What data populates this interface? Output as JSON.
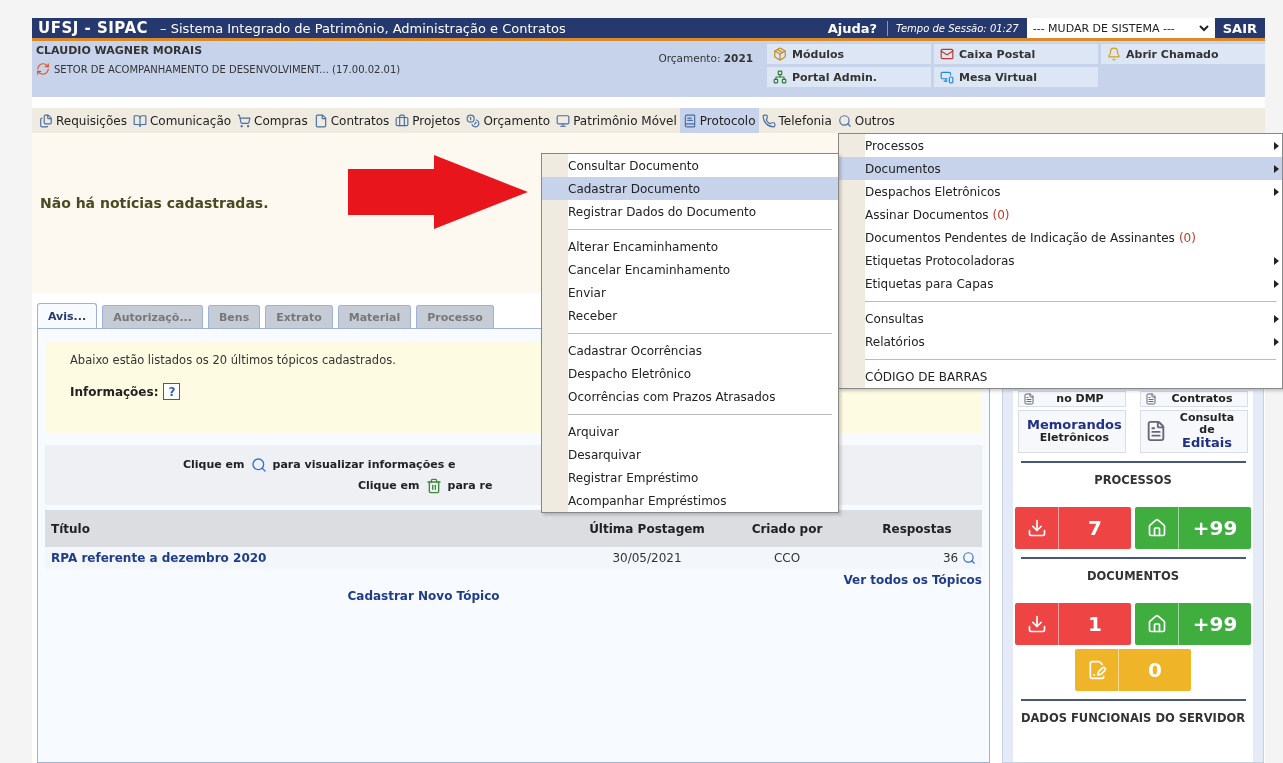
{
  "header": {
    "system": "UFSJ - SIPAC",
    "subtitle": "– Sistema Integrado de Patrimônio, Administração e Contratos",
    "help": "Ajuda?",
    "session_label": "Tempo de Sessão:",
    "session_time": "01:27",
    "system_select": "--- MUDAR DE SISTEMA ---",
    "logout": "SAIR"
  },
  "user": {
    "name": "CLAUDIO WAGNER MORAIS",
    "unit": "SETOR DE ACOMPANHAMENTO DE DESENVOLVIMENT... (17.00.02.01)",
    "budget_label": "Orçamento:",
    "budget_year": "2021"
  },
  "shortcuts": [
    {
      "kind": "modules",
      "label": "Módulos"
    },
    {
      "kind": "mail",
      "label": "Caixa Postal"
    },
    {
      "kind": "bell",
      "label": "Abrir Chamado"
    },
    {
      "kind": "portal",
      "label": "Portal Admin."
    },
    {
      "kind": "desk",
      "label": "Mesa Virtual"
    }
  ],
  "main_menu": [
    {
      "label": "Requisições",
      "selected": false
    },
    {
      "label": "Comunicação",
      "selected": false
    },
    {
      "label": "Compras",
      "selected": false
    },
    {
      "label": "Contratos",
      "selected": false
    },
    {
      "label": "Projetos",
      "selected": false
    },
    {
      "label": "Orçamento",
      "selected": false
    },
    {
      "label": "Patrimônio Móvel",
      "selected": false
    },
    {
      "label": "Protocolo",
      "selected": true
    },
    {
      "label": "Telefonia",
      "selected": false
    },
    {
      "label": "Outros",
      "selected": false
    }
  ],
  "protocol_menu": [
    [
      {
        "label": "Processos",
        "submenu": true,
        "selected": false
      },
      {
        "label": "Documentos",
        "submenu": true,
        "selected": true
      },
      {
        "label": "Despachos Eletrônicos",
        "submenu": true,
        "selected": false
      },
      {
        "label": "Assinar Documentos",
        "count": "(0)",
        "submenu": false,
        "selected": false
      },
      {
        "label": "Documentos Pendentes de Indicação de Assinantes",
        "count": "(0)",
        "submenu": false,
        "selected": false
      },
      {
        "label": "Etiquetas Protocoladoras",
        "submenu": true,
        "selected": false
      },
      {
        "label": "Etiquetas para Capas",
        "submenu": true,
        "selected": false
      }
    ],
    [
      {
        "label": "Consultas",
        "submenu": true,
        "selected": false
      },
      {
        "label": "Relatórios",
        "submenu": true,
        "selected": false
      }
    ],
    [
      {
        "label": "CÓDIGO DE BARRAS",
        "submenu": false,
        "selected": false
      }
    ]
  ],
  "documents_menu": [
    [
      {
        "label": "Consultar Documento",
        "selected": false
      },
      {
        "label": "Cadastrar Documento",
        "selected": true
      },
      {
        "label": "Registrar Dados do Documento",
        "selected": false
      }
    ],
    [
      {
        "label": "Alterar Encaminhamento",
        "selected": false
      },
      {
        "label": "Cancelar Encaminhamento",
        "selected": false
      },
      {
        "label": "Enviar",
        "selected": false
      },
      {
        "label": "Receber",
        "selected": false
      }
    ],
    [
      {
        "label": "Cadastrar Ocorrências",
        "selected": false
      },
      {
        "label": "Despacho Eletrônico",
        "selected": false
      },
      {
        "label": "Ocorrências com Prazos Atrasados",
        "selected": false
      }
    ],
    [
      {
        "label": "Arquivar",
        "selected": false
      },
      {
        "label": "Desarquivar",
        "selected": false
      },
      {
        "label": "Registrar Empréstimo",
        "selected": false
      },
      {
        "label": "Acompanhar Empréstimos",
        "selected": false
      }
    ]
  ],
  "news": "Não há notícias cadastradas.",
  "tabs": [
    {
      "label": "Avis...",
      "selected": true
    },
    {
      "label": "Autorizaçõ...",
      "selected": false
    },
    {
      "label": "Bens",
      "selected": false
    },
    {
      "label": "Extrato",
      "selected": false
    },
    {
      "label": "Material",
      "selected": false
    },
    {
      "label": "Processo",
      "selected": false
    }
  ],
  "forum": {
    "intro": "Abaixo estão listados os 20 últimos tópicos cadastrados.",
    "info_label": "Informações:",
    "info_icon": "?",
    "hints": [
      {
        "kind": "search",
        "before": "Clique em",
        "after": "para visualizar informações e"
      },
      {
        "kind": "trash",
        "before": "Clique em",
        "after": "para re"
      }
    ],
    "columns": [
      "Título",
      "Última Postagem",
      "Criado por",
      "Respostas"
    ],
    "rows": [
      {
        "title": "RPA referente a dezembro 2020",
        "last_post": "30/05/2021",
        "author": "CCO",
        "replies": "36"
      }
    ],
    "see_all": "Ver todos os Tópicos",
    "new_topic": "Cadastrar Novo Tópico"
  },
  "sidebar": {
    "tiles": [
      [
        {
          "text": "no DMP",
          "emphasis": false
        }
      ],
      [
        {
          "text": "Contratos",
          "emphasis": false
        }
      ],
      [
        {
          "text": "Memorandos",
          "emphasis": true
        },
        {
          "text": "Eletrônicos",
          "emphasis": false
        }
      ],
      [
        {
          "text": "Consulta",
          "emphasis": false
        },
        {
          "text": "de",
          "emphasis": false
        },
        {
          "text": "Editais",
          "emphasis": true
        }
      ]
    ],
    "sections": [
      {
        "title": "PROCESSOS",
        "counters": [
          {
            "kind": "inbox",
            "value": "7",
            "color": "#ef4444"
          },
          {
            "kind": "home",
            "value": "+99",
            "color": "#3fae3f"
          }
        ]
      },
      {
        "title": "DOCUMENTOS",
        "counters": [
          {
            "kind": "inbox",
            "value": "1",
            "color": "#ef4444"
          },
          {
            "kind": "home",
            "value": "+99",
            "color": "#3fae3f"
          },
          {
            "kind": "sign",
            "value": "0",
            "color": "#f0b429"
          }
        ]
      }
    ],
    "footer": "DADOS FUNCIONAIS DO SERVIDOR"
  }
}
